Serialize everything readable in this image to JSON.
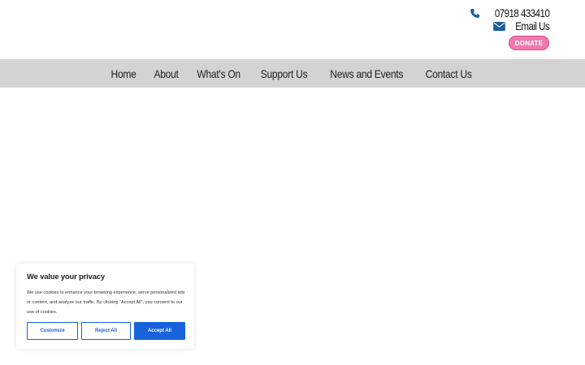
{
  "header": {
    "phone": "07918 433410",
    "email_label": "Email Us",
    "donate_label": "DONATE",
    "icons": {
      "phone": "phone-icon",
      "email": "envelope-icon"
    },
    "colors": {
      "icon": "#1a5f9e",
      "donate_bg": "#f07aae"
    }
  },
  "nav": {
    "items": [
      {
        "label": "Home"
      },
      {
        "label": "About"
      },
      {
        "label": "What's On"
      },
      {
        "label": "Support Us"
      },
      {
        "label": "News and Events"
      },
      {
        "label": "Contact Us"
      }
    ],
    "background": "#d3d3d3"
  },
  "cookie_banner": {
    "title": "We value your privacy",
    "text": "We use cookies to enhance your browsing experience, serve personalized ads or content, and analyze our traffic. By clicking \"Accept All\", you consent to our use of cookies.",
    "customize_label": "Customize",
    "reject_label": "Reject All",
    "accept_label": "Accept All",
    "accent": "#1863dc"
  }
}
